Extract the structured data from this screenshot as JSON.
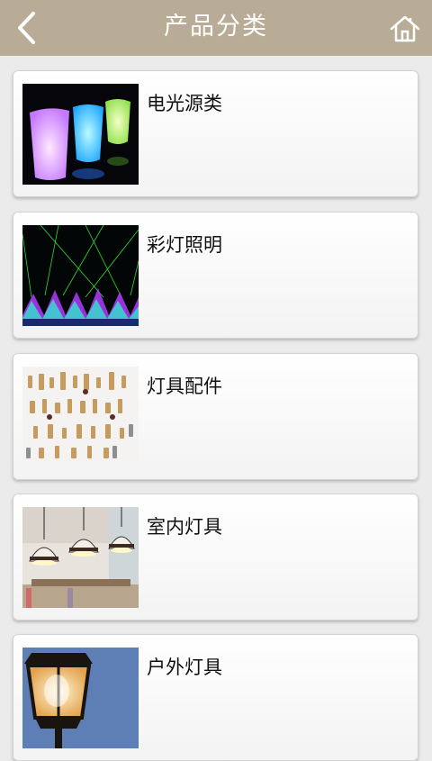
{
  "header": {
    "title": "产品分类",
    "back_icon": "chevron-left-icon",
    "home_icon": "home-icon",
    "bar_color": "#b9ac97"
  },
  "categories": [
    {
      "label": "电光源类",
      "image": "glowing-cups-image"
    },
    {
      "label": "彩灯照明",
      "image": "laser-show-image"
    },
    {
      "label": "灯具配件",
      "image": "brass-fittings-image"
    },
    {
      "label": "室内灯具",
      "image": "pendant-lamps-image"
    },
    {
      "label": "户外灯具",
      "image": "street-lantern-image"
    }
  ]
}
